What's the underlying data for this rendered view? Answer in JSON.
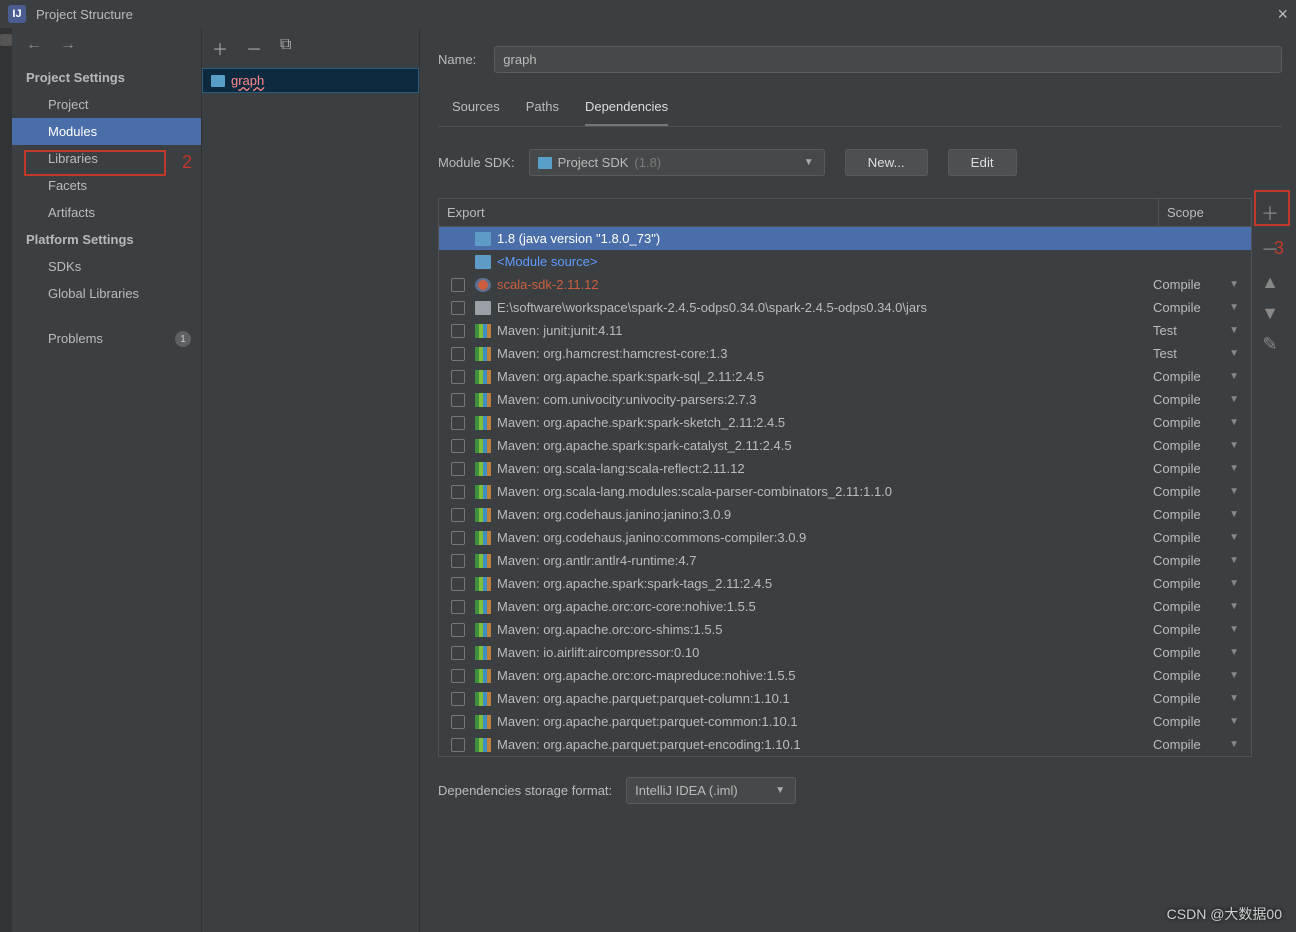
{
  "title": "Project Structure",
  "sidebar": {
    "project_settings_hdr": "Project Settings",
    "items_ps": [
      {
        "label": "Project"
      },
      {
        "label": "Modules",
        "selected": true
      },
      {
        "label": "Libraries"
      },
      {
        "label": "Facets"
      },
      {
        "label": "Artifacts"
      }
    ],
    "platform_settings_hdr": "Platform Settings",
    "items_plat": [
      {
        "label": "SDKs"
      },
      {
        "label": "Global Libraries"
      }
    ],
    "problems_label": "Problems",
    "problems_count": "1"
  },
  "module_list": {
    "graph": "graph"
  },
  "main": {
    "name_label": "Name:",
    "name_value": "graph",
    "tabs": {
      "sources": "Sources",
      "paths": "Paths",
      "deps": "Dependencies"
    },
    "sdk_label": "Module SDK:",
    "sdk_value": "Project SDK",
    "sdk_dim": "(1.8)",
    "btn_new": "New...",
    "btn_edit": "Edit",
    "head_export": "Export",
    "head_scope": "Scope",
    "storage_label": "Dependencies storage format:",
    "storage_value": "IntelliJ IDEA (.iml)"
  },
  "deps": [
    {
      "kind": "sdk",
      "name": "1.8 (java version \"1.8.0_73\")",
      "scope": "",
      "selected": true,
      "check": false
    },
    {
      "kind": "modsrc",
      "name": "<Module source>",
      "scope": "",
      "check": false
    },
    {
      "kind": "err",
      "name": "scala-sdk-2.11.12",
      "scope": "Compile",
      "check": true
    },
    {
      "kind": "folder",
      "name": "E:\\software\\workspace\\spark-2.4.5-odps0.34.0\\spark-2.4.5-odps0.34.0\\jars",
      "scope": "Compile",
      "check": true
    },
    {
      "kind": "bars",
      "name": "Maven: junit:junit:4.11",
      "scope": "Test",
      "check": true
    },
    {
      "kind": "bars",
      "name": "Maven: org.hamcrest:hamcrest-core:1.3",
      "scope": "Test",
      "check": true
    },
    {
      "kind": "bars",
      "name": "Maven: org.apache.spark:spark-sql_2.11:2.4.5",
      "scope": "Compile",
      "check": true
    },
    {
      "kind": "bars",
      "name": "Maven: com.univocity:univocity-parsers:2.7.3",
      "scope": "Compile",
      "check": true
    },
    {
      "kind": "bars",
      "name": "Maven: org.apache.spark:spark-sketch_2.11:2.4.5",
      "scope": "Compile",
      "check": true
    },
    {
      "kind": "bars",
      "name": "Maven: org.apache.spark:spark-catalyst_2.11:2.4.5",
      "scope": "Compile",
      "check": true
    },
    {
      "kind": "bars",
      "name": "Maven: org.scala-lang:scala-reflect:2.11.12",
      "scope": "Compile",
      "check": true
    },
    {
      "kind": "bars",
      "name": "Maven: org.scala-lang.modules:scala-parser-combinators_2.11:1.1.0",
      "scope": "Compile",
      "check": true
    },
    {
      "kind": "bars",
      "name": "Maven: org.codehaus.janino:janino:3.0.9",
      "scope": "Compile",
      "check": true
    },
    {
      "kind": "bars",
      "name": "Maven: org.codehaus.janino:commons-compiler:3.0.9",
      "scope": "Compile",
      "check": true
    },
    {
      "kind": "bars",
      "name": "Maven: org.antlr:antlr4-runtime:4.7",
      "scope": "Compile",
      "check": true
    },
    {
      "kind": "bars",
      "name": "Maven: org.apache.spark:spark-tags_2.11:2.4.5",
      "scope": "Compile",
      "check": true
    },
    {
      "kind": "bars",
      "name": "Maven: org.apache.orc:orc-core:nohive:1.5.5",
      "scope": "Compile",
      "check": true
    },
    {
      "kind": "bars",
      "name": "Maven: org.apache.orc:orc-shims:1.5.5",
      "scope": "Compile",
      "check": true
    },
    {
      "kind": "bars",
      "name": "Maven: io.airlift:aircompressor:0.10",
      "scope": "Compile",
      "check": true
    },
    {
      "kind": "bars",
      "name": "Maven: org.apache.orc:orc-mapreduce:nohive:1.5.5",
      "scope": "Compile",
      "check": true
    },
    {
      "kind": "bars",
      "name": "Maven: org.apache.parquet:parquet-column:1.10.1",
      "scope": "Compile",
      "check": true
    },
    {
      "kind": "bars",
      "name": "Maven: org.apache.parquet:parquet-common:1.10.1",
      "scope": "Compile",
      "check": true
    },
    {
      "kind": "bars",
      "name": "Maven: org.apache.parquet:parquet-encoding:1.10.1",
      "scope": "Compile",
      "check": true
    }
  ],
  "annotations": {
    "a1": "2",
    "a2": "3"
  },
  "watermark": "CSDN @大数据00"
}
